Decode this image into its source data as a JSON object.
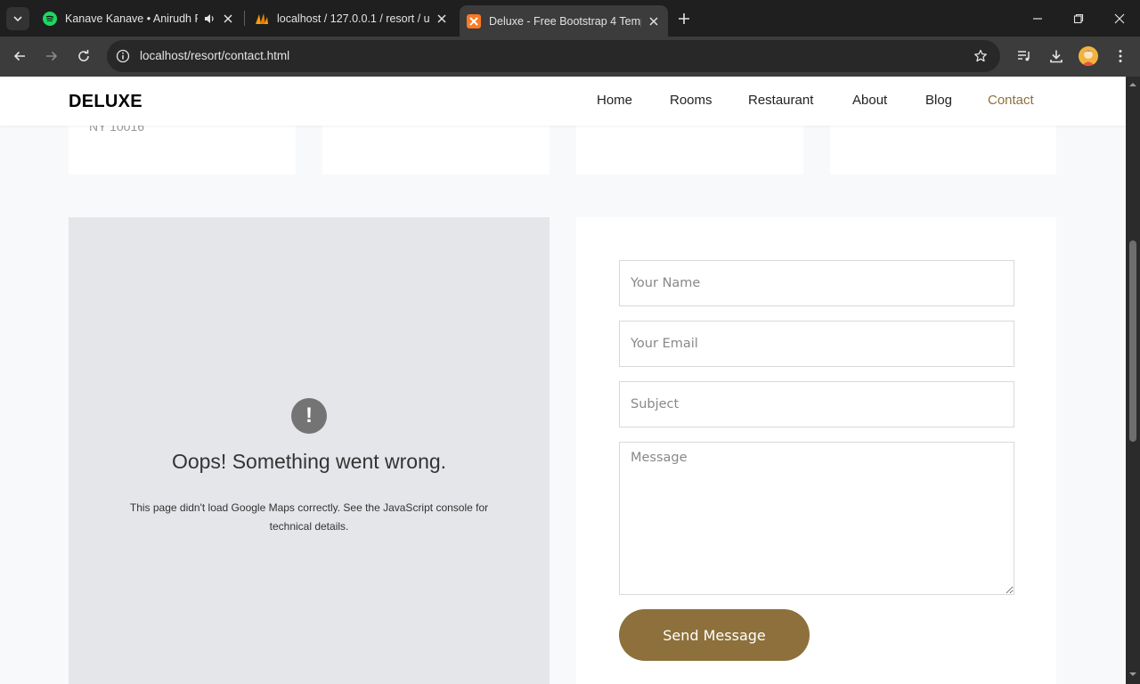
{
  "browser": {
    "tabs": [
      {
        "title": "Kanave Kanave • Anirudh Ra",
        "icon": "spotify-icon"
      },
      {
        "title": "localhost / 127.0.0.1 / resort / u",
        "icon": "phpmyadmin-icon"
      },
      {
        "title": "Deluxe - Free Bootstrap 4 Temp",
        "icon": "xampp-icon"
      }
    ],
    "url": "localhost/resort/contact.html"
  },
  "site": {
    "brand": "DELUXE",
    "nav": [
      "Home",
      "Rooms",
      "Restaurant",
      "About",
      "Blog",
      "Contact"
    ],
    "active_nav": "Contact",
    "accent_color": "#8d703b"
  },
  "contact_info": {
    "address_tail": "NY 10016"
  },
  "map_error": {
    "title": "Oops! Something went wrong.",
    "description": "This page didn't load Google Maps correctly. See the JavaScript console for technical details."
  },
  "form": {
    "name_placeholder": "Your Name",
    "email_placeholder": "Your Email",
    "subject_placeholder": "Subject",
    "message_placeholder": "Message",
    "submit_label": "Send Message"
  }
}
